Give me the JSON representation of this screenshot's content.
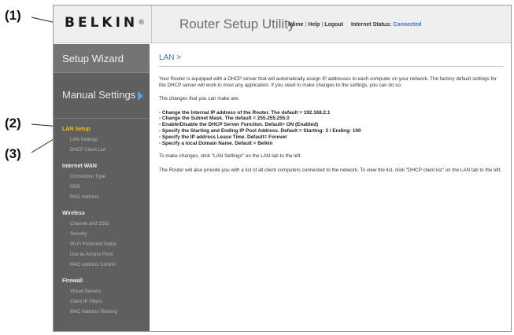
{
  "callouts": {
    "c1": "(1)",
    "c2": "(2)",
    "c3": "(3)"
  },
  "header": {
    "logo": "BELKIN",
    "logo_mark": "®",
    "title": "Router Setup Utility",
    "links": {
      "home": "Home",
      "help": "Help",
      "logout": "Logout",
      "sep": "|"
    },
    "status_label": "Internet Status:",
    "status_value": "Connected"
  },
  "sidebar": {
    "setup_wizard": "Setup Wizard",
    "manual_settings": "Manual Settings",
    "sections": [
      {
        "title": "LAN Setup",
        "items": [
          "LAN Settings",
          "DHCP Client List"
        ]
      },
      {
        "title": "Internet WAN",
        "items": [
          "Connection Type",
          "DNS",
          "MAC Address"
        ]
      },
      {
        "title": "Wireless",
        "items": [
          "Channel and SSID",
          "Security",
          "Wi-Fi Protected Setup",
          "Use as Access Point",
          "MAC Address Control"
        ]
      },
      {
        "title": "Firewall",
        "items": [
          "Virtual Servers",
          "Client IP Filters",
          "MAC Address Filtering"
        ]
      }
    ]
  },
  "main": {
    "breadcrumb": "LAN >",
    "intro": "Your Router is equipped with a DHCP server that will automatically assign IP addresses to each computer on your network. The factory default settings for the DHCP server will work in most any application. If you need to make changes to the settings, you can do so.",
    "changes_heading": "The changes that you can make are:",
    "changes": [
      "- Change the Internal IP address of the Router. The default = 192.168.2.1",
      "- Change the Subnet Mask. The default = 255.255.255.0",
      "- Enable/Disable the DHCP Server Function. Default= ON (Enabled)",
      "- Specify the Starting and Ending IP Pool Address. Default = Starting: 2 / Ending: 100",
      "- Specify the IP address Lease Time. Default= Forever",
      "- Specify a local Domain Name. Default = Belkin"
    ],
    "make_changes": "To make changes, click \"LAN Settings\" on the LAN tab to the left.",
    "client_list": "The Router will also provide you with a list of all client computers connected to the network. To view the list, click \"DHCP client list\" on the LAN tab to the left."
  },
  "colors": {
    "accent": "#3b73b8",
    "active_section": "#f2c400",
    "sidebar_bg": "#5f5f5f",
    "arrow": "#5aa0e6"
  }
}
